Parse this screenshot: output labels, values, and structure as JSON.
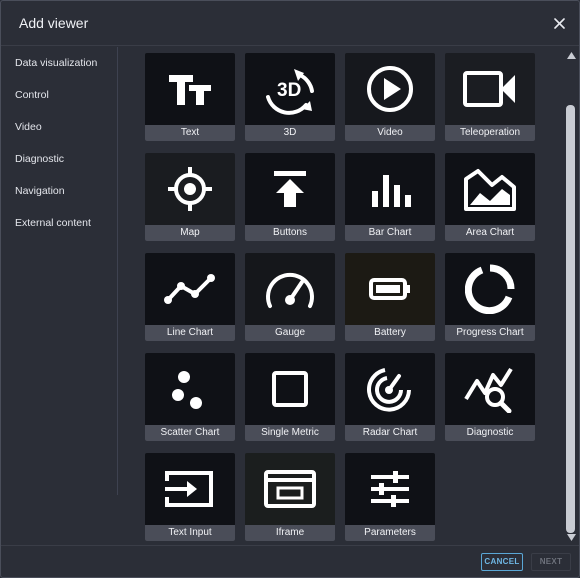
{
  "dialog": {
    "title": "Add viewer"
  },
  "sidebar": {
    "items": [
      {
        "label": "Data visualization"
      },
      {
        "label": "Control"
      },
      {
        "label": "Video"
      },
      {
        "label": "Diagnostic"
      },
      {
        "label": "Navigation"
      },
      {
        "label": "External content"
      }
    ]
  },
  "tiles": [
    {
      "label": "Text",
      "icon": "text-icon"
    },
    {
      "label": "3D",
      "icon": "3d-icon"
    },
    {
      "label": "Video",
      "icon": "play-icon"
    },
    {
      "label": "Teleoperation",
      "icon": "video-camera-icon"
    },
    {
      "label": "Map",
      "icon": "crosshair-icon"
    },
    {
      "label": "Buttons",
      "icon": "upload-arrow-icon"
    },
    {
      "label": "Bar Chart",
      "icon": "bar-chart-icon"
    },
    {
      "label": "Area Chart",
      "icon": "area-chart-icon"
    },
    {
      "label": "Line Chart",
      "icon": "line-chart-icon"
    },
    {
      "label": "Gauge",
      "icon": "gauge-icon"
    },
    {
      "label": "Battery",
      "icon": "battery-icon"
    },
    {
      "label": "Progress Chart",
      "icon": "progress-ring-icon"
    },
    {
      "label": "Scatter Chart",
      "icon": "scatter-icon"
    },
    {
      "label": "Single Metric",
      "icon": "single-metric-icon"
    },
    {
      "label": "Radar Chart",
      "icon": "radar-icon"
    },
    {
      "label": "Diagnostic",
      "icon": "diagnostic-icon"
    },
    {
      "label": "Text Input",
      "icon": "text-input-icon"
    },
    {
      "label": "Iframe",
      "icon": "iframe-icon"
    },
    {
      "label": "Parameters",
      "icon": "sliders-icon"
    }
  ],
  "footer": {
    "cancel_label": "CANCEL",
    "next_label": "NEXT"
  },
  "colors": {
    "accent": "#5aa7d6",
    "background": "#2b2e37",
    "tile_label_bg": "#4a4d58"
  }
}
